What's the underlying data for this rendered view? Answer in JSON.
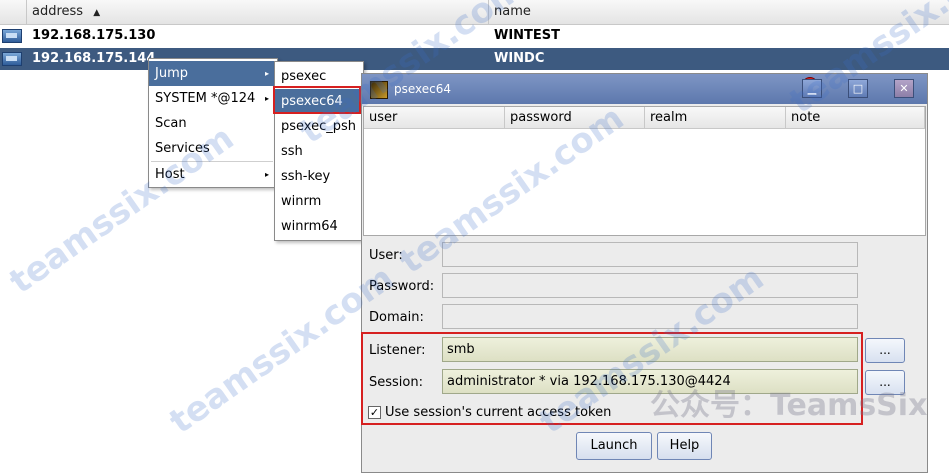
{
  "table": {
    "headers": {
      "address": "address",
      "address_sort": "▲",
      "name": "name"
    },
    "rows": [
      {
        "address": "192.168.175.130",
        "name": "WINTEST",
        "selected": false
      },
      {
        "address": "192.168.175.144",
        "name": "WINDC",
        "selected": true
      }
    ]
  },
  "context_menu": {
    "items": [
      "Jump",
      "SYSTEM *@124",
      "Scan",
      "Services",
      "Host"
    ],
    "submenu_arrow": "▸"
  },
  "jump_submenu": {
    "items": [
      "psexec",
      "psexec64",
      "psexec_psh",
      "ssh",
      "ssh-key",
      "winrm",
      "winrm64"
    ],
    "highlighted": "psexec64"
  },
  "dialog": {
    "title": "psexec64",
    "columns": [
      "user",
      "password",
      "realm",
      "note"
    ],
    "labels": {
      "user": "User:",
      "password": "Password:",
      "domain": "Domain:",
      "listener": "Listener:",
      "session": "Session:"
    },
    "values": {
      "user": "",
      "password": "",
      "domain": "",
      "listener": "smb",
      "session": "administrator * via  192.168.175.130@4424"
    },
    "browse_label": "...",
    "checkbox_label": "Use session's current access token",
    "checkbox_checked": "✓",
    "buttons": {
      "launch": "Launch",
      "help": "Help"
    }
  },
  "watermark": {
    "text": "teamssix.com",
    "wechat": "公众号：TeamsSix"
  },
  "colors": {
    "selection": "#3d5a80",
    "menu_active": "#4a6e9c",
    "highlight_box": "#d62020",
    "titlebar": "#6a82b6"
  }
}
